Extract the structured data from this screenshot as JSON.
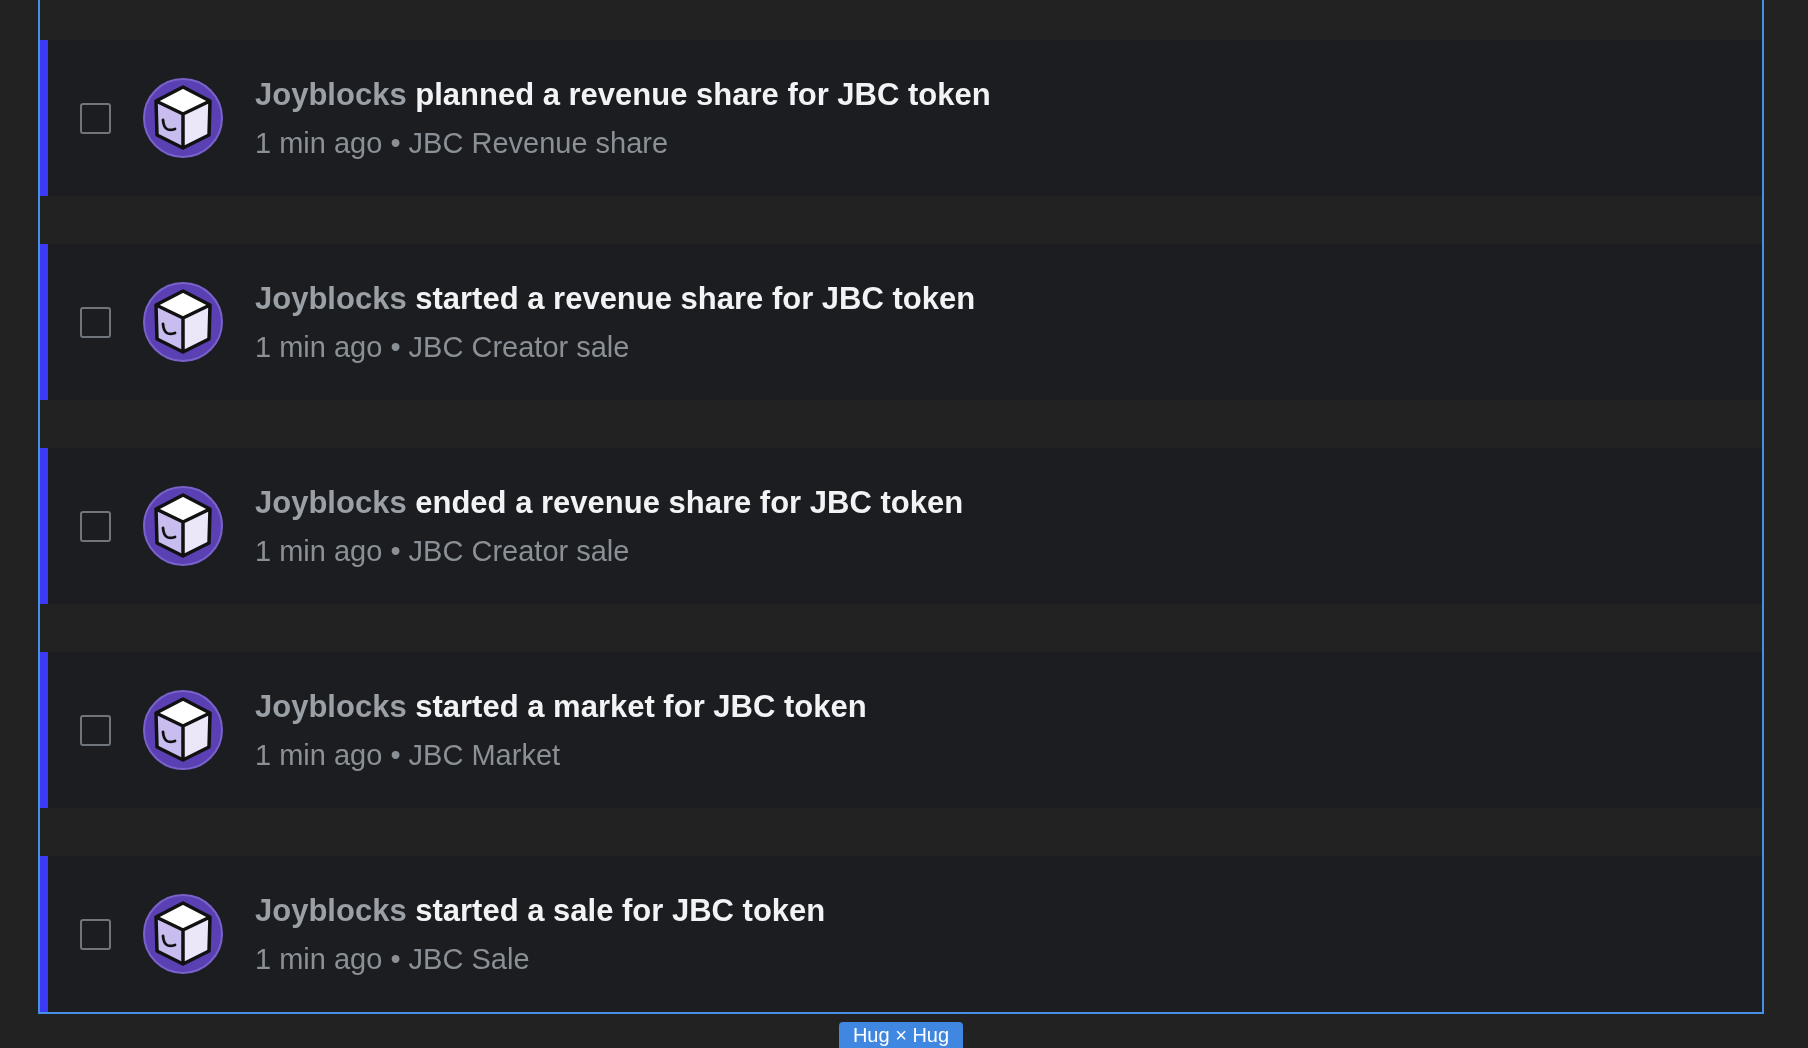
{
  "activities": [
    {
      "actor": "Joyblocks",
      "action": "planned a revenue share for JBC token",
      "meta": "1 min ago • JBC Revenue share",
      "checked": false,
      "unread": true
    },
    {
      "actor": "Joyblocks",
      "action": "started a revenue share for JBC token",
      "meta": "1 min ago • JBC Creator sale",
      "checked": false,
      "unread": true
    },
    {
      "actor": "Joyblocks",
      "action": "ended a revenue share for JBC token",
      "meta": "1 min ago • JBC Creator sale",
      "checked": false,
      "unread": true
    },
    {
      "actor": "Joyblocks",
      "action": "started a market for JBC token",
      "meta": "1 min ago • JBC Market",
      "checked": false,
      "unread": true
    },
    {
      "actor": "Joyblocks",
      "action": "started a sale for JBC token",
      "meta": "1 min ago • JBC Sale",
      "checked": false,
      "unread": true
    }
  ],
  "size_badge": {
    "label": "Hug × Hug"
  }
}
